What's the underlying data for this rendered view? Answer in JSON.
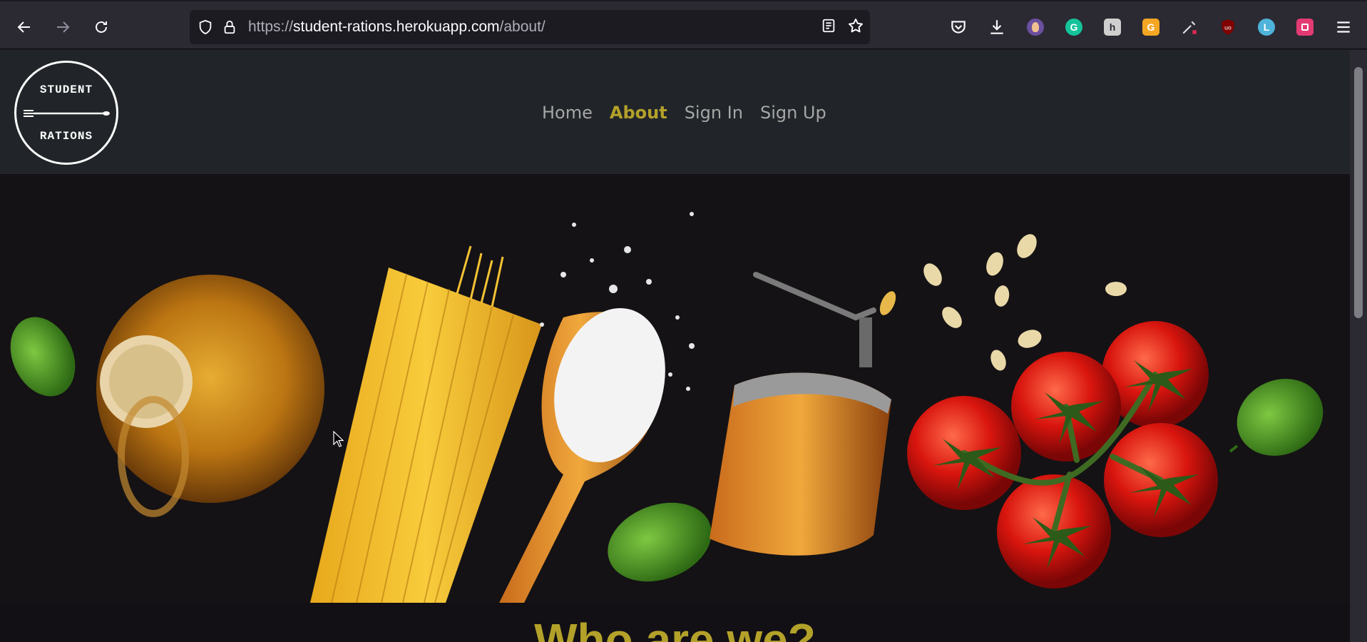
{
  "browser": {
    "url_prefix": "https://",
    "url_host": "student-rations.herokuapp.com",
    "url_path": "/about/",
    "icons": {
      "back": "back-arrow-icon",
      "forward": "forward-arrow-icon",
      "reload": "reload-icon",
      "tracking": "shield-icon",
      "lock": "lock-icon",
      "reader": "reader-view-icon",
      "bookmark": "star-icon",
      "pocket": "pocket-icon",
      "downloads": "download-icon",
      "menu": "hamburger-menu-icon"
    },
    "extensions": [
      {
        "name": "avatar-extension",
        "glyph": "",
        "color": "#6b4fa0"
      },
      {
        "name": "grammarly-extension",
        "glyph": "G",
        "color": "#15c39a"
      },
      {
        "name": "h-extension",
        "glyph": "h",
        "color": "#cfcfcf"
      },
      {
        "name": "g-extension",
        "glyph": "G",
        "color": "#f5a623"
      },
      {
        "name": "eyedropper-extension",
        "glyph": "",
        "color": "#2b2a33"
      },
      {
        "name": "ublock-extension",
        "glyph": "uo",
        "color": "#800000"
      },
      {
        "name": "l-extension",
        "glyph": "L",
        "color": "#4fb3d9"
      },
      {
        "name": "square-extension",
        "glyph": "",
        "color": "#e33a73"
      }
    ]
  },
  "site": {
    "logo_top": "STUDENT",
    "logo_bottom": "RATIONS",
    "nav": [
      {
        "label": "Home",
        "active": false
      },
      {
        "label": "About",
        "active": true
      },
      {
        "label": "Sign In",
        "active": false
      },
      {
        "label": "Sign Up",
        "active": false
      }
    ],
    "hero_alt": "",
    "heading": "Who are we?"
  },
  "colors": {
    "accent": "#b3a12a",
    "header_bg": "#212529",
    "nav_text": "#a6a6a6"
  }
}
